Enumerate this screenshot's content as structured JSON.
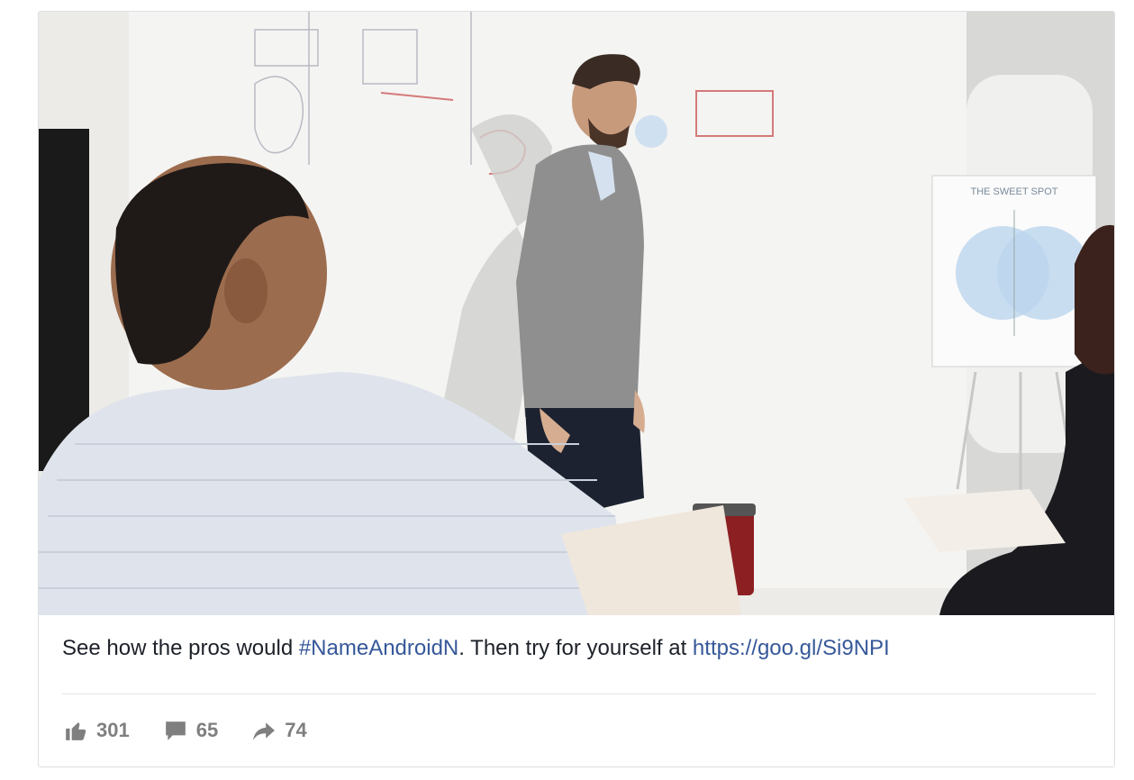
{
  "post": {
    "caption": {
      "text_before": "See how the pros would ",
      "hashtag": "#NameAndroidN",
      "text_middle": ". Then try for yourself at ",
      "link": "https://goo.gl/Si9NPI"
    },
    "video": {
      "flipchart_title": "THE SWEET SPOT"
    },
    "stats": {
      "likes": "301",
      "comments": "65",
      "shares": "74"
    }
  },
  "colors": {
    "link": "#365899",
    "text": "#1d2129",
    "stat": "#7f7f7f",
    "border": "#dddfe2"
  },
  "icons": {
    "likes": "thumbs-up-icon",
    "comments": "comment-icon",
    "shares": "share-arrow-icon"
  }
}
